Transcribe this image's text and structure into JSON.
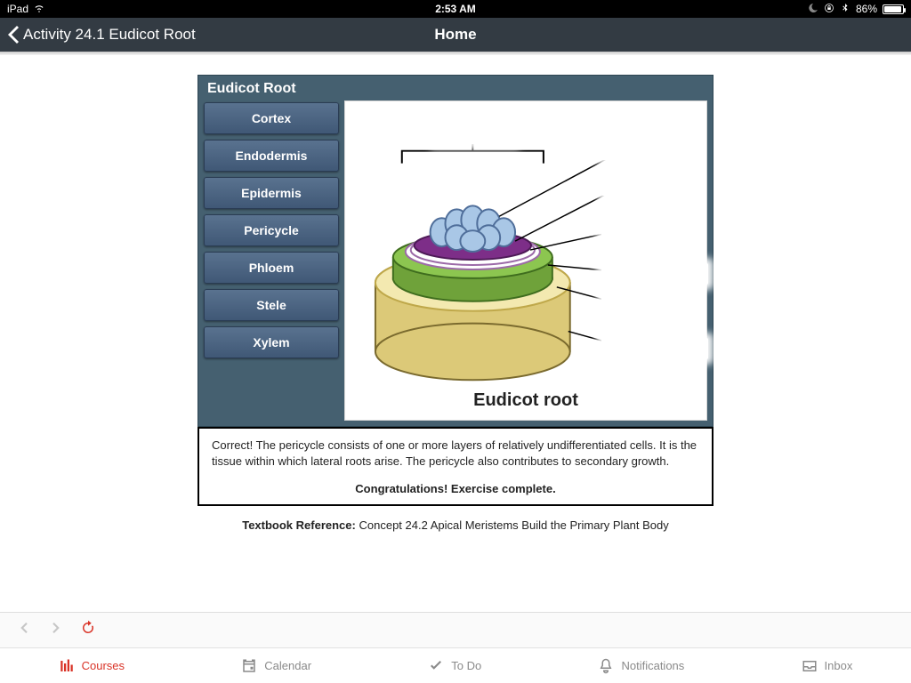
{
  "status": {
    "device": "iPad",
    "time": "2:53 AM",
    "battery_pct": "86%"
  },
  "nav": {
    "back_label": "Activity 24.1 Eudicot Root",
    "title": "Home"
  },
  "card": {
    "title": "Eudicot Root",
    "terms": [
      "Cortex",
      "Endodermis",
      "Epidermis",
      "Pericycle",
      "Phloem",
      "Stele",
      "Xylem"
    ],
    "diagram_caption": "Eudicot root"
  },
  "feedback": {
    "text": "Correct! The pericycle consists of one or more layers of relatively undifferentiated cells. It is the tissue within which lateral roots arise. The pericycle also contributes to secondary growth.",
    "congrats": "Congratulations! Exercise complete."
  },
  "reference": {
    "label": "Textbook Reference:",
    "text": "Concept 24.2 Apical Meristems Build the Primary Plant Body"
  },
  "tabs": {
    "courses": "Courses",
    "calendar": "Calendar",
    "todo": "To Do",
    "notifications": "Notifications",
    "inbox": "Inbox"
  }
}
